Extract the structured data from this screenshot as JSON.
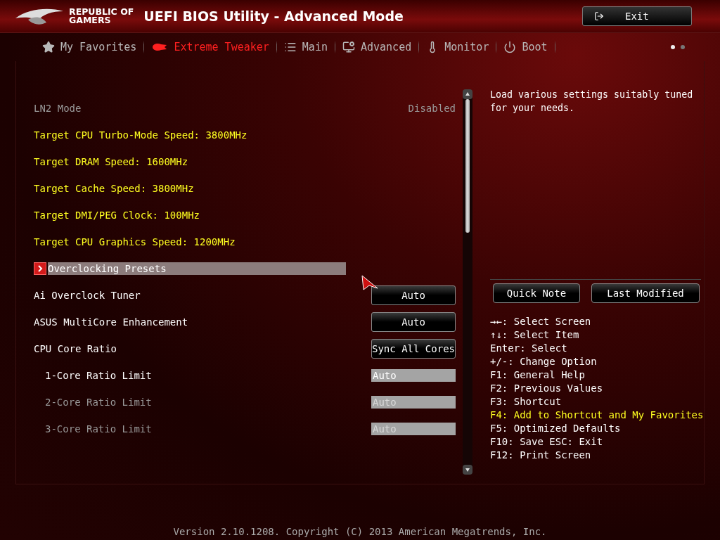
{
  "header": {
    "logo_line1": "REPUBLIC OF",
    "logo_line2": "GAMERS",
    "title": "UEFI BIOS Utility - Advanced Mode",
    "exit_button": "Exit"
  },
  "tabs": [
    {
      "label": "My Favorites",
      "selected": false
    },
    {
      "label": "Extreme Tweaker",
      "selected": true
    },
    {
      "label": "Main",
      "selected": false
    },
    {
      "label": "Advanced",
      "selected": false
    },
    {
      "label": "Monitor",
      "selected": false
    },
    {
      "label": "Boot",
      "selected": false
    }
  ],
  "page_dots": [
    {
      "selected": true
    },
    {
      "selected": false
    }
  ],
  "settings": [
    {
      "kind": "value",
      "label": "LN2 Mode",
      "value": "Disabled",
      "disabled": true
    },
    {
      "kind": "info",
      "label": "Target CPU Turbo-Mode Speed: 3800MHz"
    },
    {
      "kind": "info",
      "label": "Target DRAM Speed: 1600MHz"
    },
    {
      "kind": "info",
      "label": "Target Cache Speed: 3800MHz"
    },
    {
      "kind": "info",
      "label": "Target DMI/PEG Clock: 100MHz"
    },
    {
      "kind": "info",
      "label": "Target CPU Graphics Speed: 1200MHz"
    },
    {
      "kind": "submenu",
      "label": "Overclocking Presets",
      "selected": true
    },
    {
      "kind": "button",
      "label": "Ai Overclock Tuner",
      "value": "Auto"
    },
    {
      "kind": "button",
      "label": "ASUS MultiCore Enhancement",
      "value": "Auto"
    },
    {
      "kind": "button",
      "label": "CPU Core Ratio",
      "value": "Sync All Cores"
    },
    {
      "kind": "field",
      "label": "1-Core Ratio Limit",
      "value": "Auto",
      "disabled": false
    },
    {
      "kind": "field",
      "label": "2-Core Ratio Limit",
      "value": "Auto",
      "disabled": true
    },
    {
      "kind": "field",
      "label": "3-Core Ratio Limit",
      "value": "Auto",
      "disabled": true
    }
  ],
  "help": {
    "description": "Load various settings suitably tuned for your needs.",
    "buttons": [
      "Quick Note",
      "Last Modified"
    ],
    "keys": [
      {
        "text": "→←: Select Screen",
        "highlighted": false
      },
      {
        "text": "↑↓: Select Item",
        "highlighted": false
      },
      {
        "text": "Enter: Select",
        "highlighted": false
      },
      {
        "text": "+/-: Change Option",
        "highlighted": false
      },
      {
        "text": "F1: General Help",
        "highlighted": false
      },
      {
        "text": "F2: Previous Values",
        "highlighted": false
      },
      {
        "text": "F3: Shortcut",
        "highlighted": false
      },
      {
        "text": "F4: Add to Shortcut and My Favorites",
        "highlighted": true
      },
      {
        "text": "F5: Optimized Defaults",
        "highlighted": false
      },
      {
        "text": "F10: Save  ESC: Exit",
        "highlighted": false
      },
      {
        "text": "F12: Print Screen",
        "highlighted": false
      }
    ]
  },
  "footer": {
    "version": "Version 2.10.1208. Copyright (C) 2013 American Megatrends, Inc."
  }
}
